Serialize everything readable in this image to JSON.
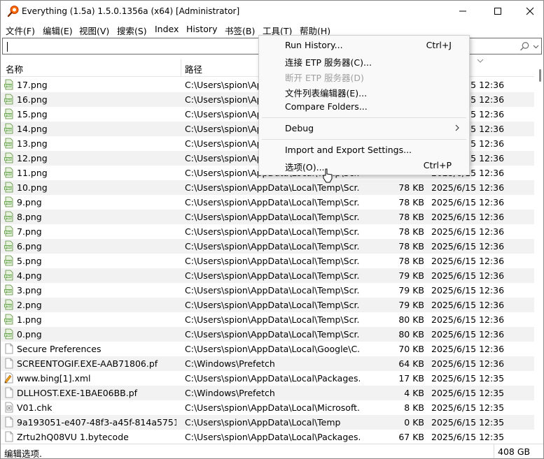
{
  "window": {
    "title": "Everything (1.5a) 1.5.0.1356a (x64) [Administrator]",
    "buttons": {
      "minimize": "—",
      "maximize": "☐",
      "close": "✕"
    }
  },
  "menubar": [
    "文件(F)",
    "编辑(E)",
    "视图(V)",
    "搜索(S)",
    "Index",
    "History",
    "书签(B)",
    "工具(T)",
    "帮助(H)"
  ],
  "search": {
    "value": "",
    "placeholder": ""
  },
  "columns": {
    "name": "名称",
    "path": "路径"
  },
  "rows": [
    {
      "icon": "png-file-icon",
      "name": "17.png",
      "path": "C:\\Users\\spion\\AppData\\Local\\Temp\\Scr...",
      "size": "",
      "date": "2025/6/15 12:36"
    },
    {
      "icon": "png-file-icon",
      "name": "16.png",
      "path": "C:\\Users\\spion\\AppData\\Local\\Temp\\Scr...",
      "size": "",
      "date": "2025/6/15 12:36"
    },
    {
      "icon": "png-file-icon",
      "name": "15.png",
      "path": "C:\\Users\\spion\\AppData\\Local\\Temp\\Scr...",
      "size": "",
      "date": "2025/6/15 12:36"
    },
    {
      "icon": "png-file-icon",
      "name": "14.png",
      "path": "C:\\Users\\spion\\AppData\\Local\\Temp\\Scr...",
      "size": "",
      "date": "2025/6/15 12:36"
    },
    {
      "icon": "png-file-icon",
      "name": "13.png",
      "path": "C:\\Users\\spion\\AppData\\Local\\Temp\\Scr...",
      "size": "",
      "date": "2025/6/15 12:36"
    },
    {
      "icon": "png-file-icon",
      "name": "12.png",
      "path": "C:\\Users\\spion\\AppData\\Local\\Temp\\Scr...",
      "size": "",
      "date": "2025/6/15 12:36"
    },
    {
      "icon": "png-file-icon",
      "name": "11.png",
      "path": "C:\\Users\\spion\\AppData\\Local\\Temp\\Scr...",
      "size": "",
      "date": "2025/6/15 12:36"
    },
    {
      "icon": "png-file-icon",
      "name": "10.png",
      "path": "C:\\Users\\spion\\AppData\\Local\\Temp\\Scr...",
      "size": "78 KB",
      "date": "2025/6/15 12:36"
    },
    {
      "icon": "png-file-icon",
      "name": "9.png",
      "path": "C:\\Users\\spion\\AppData\\Local\\Temp\\Scr...",
      "size": "78 KB",
      "date": "2025/6/15 12:36"
    },
    {
      "icon": "png-file-icon",
      "name": "8.png",
      "path": "C:\\Users\\spion\\AppData\\Local\\Temp\\Scr...",
      "size": "78 KB",
      "date": "2025/6/15 12:36"
    },
    {
      "icon": "png-file-icon",
      "name": "7.png",
      "path": "C:\\Users\\spion\\AppData\\Local\\Temp\\Scr...",
      "size": "78 KB",
      "date": "2025/6/15 12:36"
    },
    {
      "icon": "png-file-icon",
      "name": "6.png",
      "path": "C:\\Users\\spion\\AppData\\Local\\Temp\\Scr...",
      "size": "78 KB",
      "date": "2025/6/15 12:36"
    },
    {
      "icon": "png-file-icon",
      "name": "5.png",
      "path": "C:\\Users\\spion\\AppData\\Local\\Temp\\Scr...",
      "size": "78 KB",
      "date": "2025/6/15 12:36"
    },
    {
      "icon": "png-file-icon",
      "name": "4.png",
      "path": "C:\\Users\\spion\\AppData\\Local\\Temp\\Scr...",
      "size": "79 KB",
      "date": "2025/6/15 12:36"
    },
    {
      "icon": "png-file-icon",
      "name": "3.png",
      "path": "C:\\Users\\spion\\AppData\\Local\\Temp\\Scr...",
      "size": "79 KB",
      "date": "2025/6/15 12:36"
    },
    {
      "icon": "png-file-icon",
      "name": "2.png",
      "path": "C:\\Users\\spion\\AppData\\Local\\Temp\\Scr...",
      "size": "79 KB",
      "date": "2025/6/15 12:36"
    },
    {
      "icon": "png-file-icon",
      "name": "1.png",
      "path": "C:\\Users\\spion\\AppData\\Local\\Temp\\Scr...",
      "size": "80 KB",
      "date": "2025/6/15 12:36"
    },
    {
      "icon": "png-file-icon",
      "name": "0.png",
      "path": "C:\\Users\\spion\\AppData\\Local\\Temp\\Scr...",
      "size": "80 KB",
      "date": "2025/6/15 12:36"
    },
    {
      "icon": "file-icon",
      "name": "Secure Preferences",
      "path": "C:\\Users\\spion\\AppData\\Local\\Google\\C...",
      "size": "70 KB",
      "date": "2025/6/15 12:36"
    },
    {
      "icon": "file-icon",
      "name": "SCREENTOGIF.EXE-AAB71806.pf",
      "path": "C:\\Windows\\Prefetch",
      "size": "64 KB",
      "date": "2025/6/15 12:36"
    },
    {
      "icon": "xml-file-icon",
      "name": "www.bing[1].xml",
      "path": "C:\\Users\\spion\\AppData\\Local\\Packages...",
      "size": "17 KB",
      "date": "2025/6/15 12:35"
    },
    {
      "icon": "file-icon",
      "name": "DLLHOST.EXE-1BAE06BB.pf",
      "path": "C:\\Windows\\Prefetch",
      "size": "4 KB",
      "date": "2025/6/15 12:35"
    },
    {
      "icon": "chk-file-icon",
      "name": "V01.chk",
      "path": "C:\\Users\\spion\\AppData\\Local\\Microsoft...",
      "size": "8 KB",
      "date": "2025/6/15 12:35"
    },
    {
      "icon": "file-icon",
      "name": "9a193051-e407-48f3-a45f-814a5751b...",
      "path": "C:\\Users\\spion\\AppData\\Local\\Temp",
      "size": "0 KB",
      "date": "2025/6/15 12:35"
    },
    {
      "icon": "file-icon",
      "name": "Zrtu2hQ08VU 1.bytecode",
      "path": "C:\\Users\\spion\\AppData\\Local\\Packages...",
      "size": "67 KB",
      "date": "2025/6/15 12:35"
    }
  ],
  "dropdown": {
    "items": [
      {
        "label": "Run History...",
        "shortcut": "Ctrl+J",
        "disabled": false
      },
      {
        "label": "连接 ETP 服务器(C)...",
        "shortcut": "",
        "disabled": false
      },
      {
        "label": "断开 ETP 服务器(D)",
        "shortcut": "",
        "disabled": true
      },
      {
        "label": "文件列表编辑器(E)...",
        "shortcut": "",
        "disabled": false
      },
      {
        "label": "Compare Folders...",
        "shortcut": "",
        "disabled": false
      },
      {
        "label": "Debug",
        "shortcut": "",
        "disabled": false,
        "submenu": true
      },
      {
        "label": "Import and Export Settings...",
        "shortcut": "",
        "disabled": false
      },
      {
        "label": "选项(O)...",
        "shortcut": "Ctrl+P",
        "disabled": false
      }
    ]
  },
  "status": {
    "text": "编辑选项.",
    "size": "408 GB"
  }
}
